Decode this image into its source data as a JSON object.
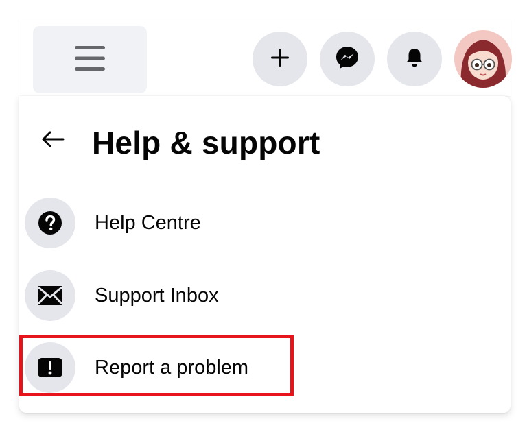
{
  "header": {
    "menu_icon": "hamburger-menu-icon",
    "create_icon": "plus-icon",
    "messenger_icon": "messenger-icon",
    "notifications_icon": "bell-icon",
    "avatar_icon": "profile-avatar"
  },
  "panel": {
    "back_icon": "arrow-left-icon",
    "title": "Help & support",
    "items": [
      {
        "label": "Help Centre",
        "icon": "question-circle-icon"
      },
      {
        "label": "Support Inbox",
        "icon": "envelope-icon"
      },
      {
        "label": "Report a problem",
        "icon": "exclamation-square-icon",
        "highlighted": true
      }
    ]
  },
  "colors": {
    "icon_bg": "#e4e6eb",
    "menu_bg": "#f0f2f5",
    "text": "#050505",
    "highlight": "#e8141c"
  }
}
